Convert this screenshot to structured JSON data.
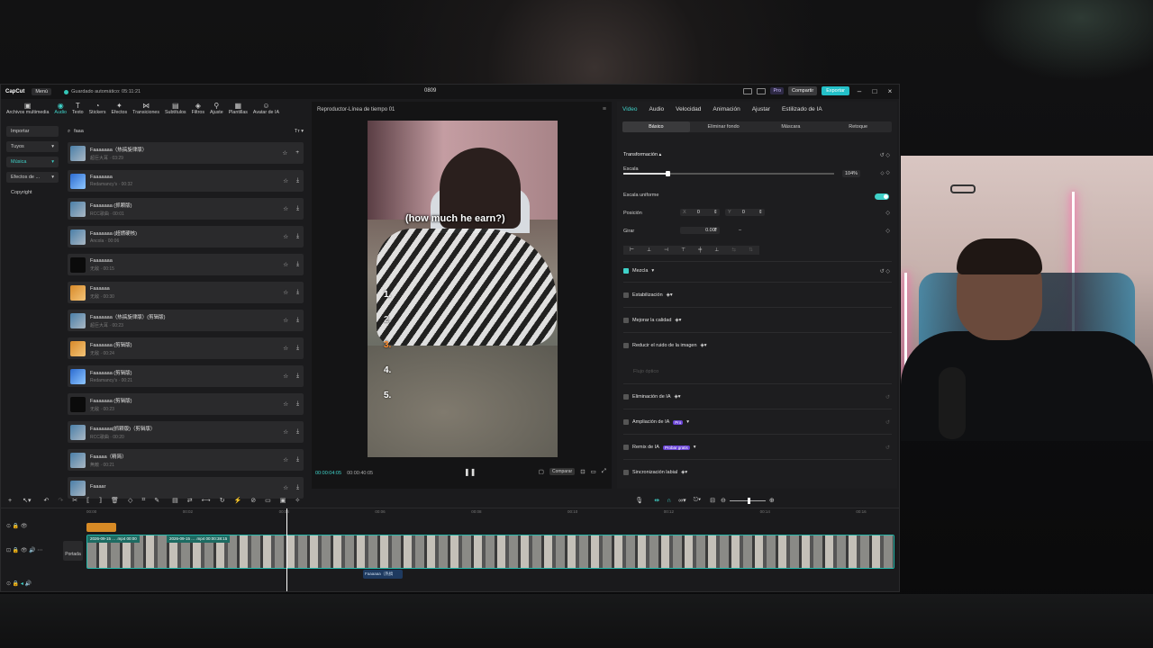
{
  "app": {
    "logo": "CapCut",
    "menu": "Menú",
    "autosave": "Guardado automático: 05:11:21",
    "project_title": "0809",
    "pro": "Pro",
    "share": "Compartir",
    "export": "Exportar"
  },
  "toolbar": [
    {
      "icon": "media-icon",
      "glyph": "▣",
      "label": "Archivos multimedia"
    },
    {
      "icon": "audio-icon",
      "glyph": "◉",
      "label": "Audio",
      "active": true
    },
    {
      "icon": "text-icon",
      "glyph": "T",
      "label": "Texto"
    },
    {
      "icon": "sticker-icon",
      "glyph": "◔",
      "label": "Stickers"
    },
    {
      "icon": "effects-icon",
      "glyph": "✦",
      "label": "Efectos"
    },
    {
      "icon": "transitions-icon",
      "glyph": "⋈",
      "label": "Transiciones"
    },
    {
      "icon": "subtitles-icon",
      "glyph": "▤",
      "label": "Subtítulos"
    },
    {
      "icon": "filters-icon",
      "glyph": "◈",
      "label": "Filtros"
    },
    {
      "icon": "adjust-icon",
      "glyph": "⚲",
      "label": "Ajuste"
    },
    {
      "icon": "templates-icon",
      "glyph": "▦",
      "label": "Plantillas"
    },
    {
      "icon": "avatar-icon",
      "glyph": "☺",
      "label": "Avatar de IA"
    }
  ],
  "left_categories": [
    "Importar",
    "Tuyos",
    "Música",
    "Efectos de ...",
    "Copyright"
  ],
  "search": {
    "value": "faaa"
  },
  "tracks": [
    {
      "name": "Faaaaaaa（热搞旋律版）",
      "meta": "超巨大耳 · 03:29",
      "thumb": "normal"
    },
    {
      "name": "Faaaaaaa",
      "meta": "Redamancy's · 00:32",
      "thumb": "blue"
    },
    {
      "name": "Faaaaaaa (抓颗版)",
      "meta": "RCC歌曲 · 00:01",
      "thumb": "normal"
    },
    {
      "name": "Faaaaaaa (超燃硬核)",
      "meta": "Ancola · 00:06",
      "thumb": "normal"
    },
    {
      "name": "Faaaaaaa",
      "meta": "无敌 · 00:15",
      "thumb": "dark"
    },
    {
      "name": "Faaaaaa",
      "meta": "无敌 · 00:30",
      "thumb": "orange"
    },
    {
      "name": "Faaaaaaa（热搞旋律版）(剪辑版)",
      "meta": "超巨大耳 · 00:23",
      "thumb": "normal"
    },
    {
      "name": "Faaaaaaa (剪辑版)",
      "meta": "无敌 · 00:24",
      "thumb": "orange"
    },
    {
      "name": "Faaaaaaa (剪辑版)",
      "meta": "Redamancy's · 00:21",
      "thumb": "blue"
    },
    {
      "name": "Faaaaaaa (剪辑版)",
      "meta": "无敌 · 00:23",
      "thumb": "dark"
    },
    {
      "name": "Faaaaaaa(抓颗版)（剪辑版）",
      "meta": "RCC歌曲 · 00:20",
      "thumb": "normal"
    },
    {
      "name": "Faaaaa（精简）",
      "meta": "無敵 · 00:21",
      "thumb": "normal"
    },
    {
      "name": "Faaaar",
      "meta": "",
      "thumb": "normal"
    }
  ],
  "player": {
    "title": "Reproductor-Línea de tiempo 01",
    "caption": "(how much he earn?)",
    "numbers": [
      "1.",
      "2.",
      "3.",
      "4.",
      "5."
    ],
    "current_time": "00:00:04:05",
    "total_time": "00:00:40:05",
    "compare": "Comparar"
  },
  "right_panel": {
    "tabs": [
      "Video",
      "Audio",
      "Velocidad",
      "Animación",
      "Ajustar",
      "Estilizado de IA"
    ],
    "subtabs": [
      "Básico",
      "Eliminar fondo",
      "Máscara",
      "Retoque"
    ],
    "transform": "Transformación",
    "scale_label": "Escala",
    "scale_value": "104%",
    "scale_fraction": 0.21,
    "uniform_scale": "Escala uniforme",
    "position_label": "Posición",
    "x_label": "X",
    "x_value": "0",
    "y_label": "Y",
    "y_value": "0",
    "rotate_label": "Girar",
    "rotate_value": "0.00°",
    "rotate_dash": "–",
    "blend": "Mezcla",
    "stabilization": "Estabilización",
    "enhance": "Mejorar la calidad",
    "noise": "Reducir el ruido de la imagen",
    "flujo": "Flujo óptico",
    "remove_ai": "Eliminación de IA",
    "upscale_ai": "Ampliación de IA",
    "upscale_badge": "Pro",
    "remix_ai": "Remix de IA",
    "remix_badge": "Probar gratis",
    "lipsync": "Sincronización labial"
  },
  "timeline": {
    "ruler": [
      "00:00",
      "00:02",
      "00:04",
      "00:06",
      "00:08",
      "00:10",
      "00:12",
      "00:14",
      "00:16"
    ],
    "clip_label_1": "2026-09-15 ... .mp4  00:00",
    "clip_label_2": "2026-09-15 ... .mp4  00:00:38:15",
    "cover": "Portada",
    "audio_clip": "Faaaaaa（热搞"
  }
}
